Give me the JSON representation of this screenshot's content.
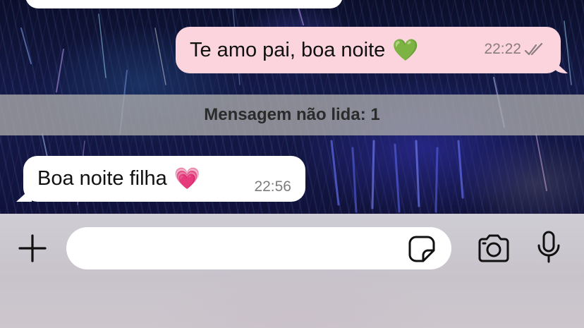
{
  "conversation": {
    "messages": [
      {
        "direction": "outgoing",
        "text": "Te amo pai, boa noite",
        "emoji": "💚",
        "time": "22:22",
        "status": "read"
      },
      {
        "direction": "incoming",
        "text": "Boa noite filha",
        "emoji": "💗",
        "time": "22:56"
      }
    ],
    "unread_banner": "Mensagem não lida: 1"
  },
  "input_bar": {
    "message_value": "",
    "icons": {
      "attach": "plus-icon",
      "sticker": "sticker-icon",
      "camera": "camera-icon",
      "voice": "microphone-icon"
    }
  },
  "colors": {
    "outgoing_bubble": "#fbd4de",
    "incoming_bubble": "#ffffff",
    "unread_banner": "#aaaaaa",
    "input_bar_bg": "#cdc9cf"
  }
}
